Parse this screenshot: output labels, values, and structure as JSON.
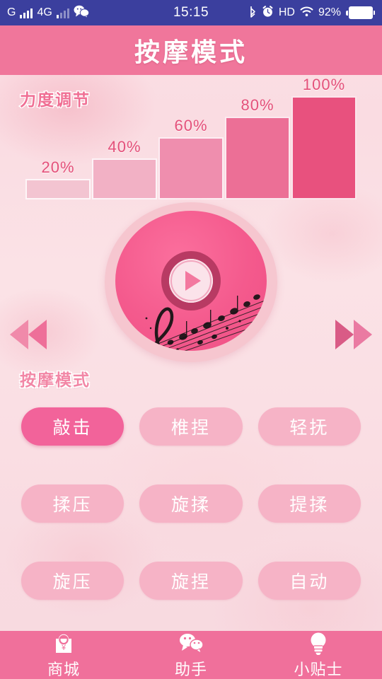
{
  "status_bar": {
    "carrier": "G",
    "network": "4G",
    "wechat_icon": "wechat-icon",
    "time": "15:15",
    "bluetooth_icon": "bluetooth-icon",
    "alarm_icon": "alarm-icon",
    "hd_label": "HD",
    "wifi_icon": "wifi-icon",
    "battery_percent": "92%",
    "background_color": "#3b3f9e"
  },
  "header": {
    "title": "按摩模式",
    "background_color": "#f0769b"
  },
  "intensity": {
    "label": "力度调节"
  },
  "chart_data": {
    "type": "bar",
    "title": "力度调节",
    "categories": [
      "20%",
      "40%",
      "60%",
      "80%",
      "100%"
    ],
    "values": [
      20,
      40,
      60,
      80,
      100
    ],
    "labels": [
      "20%",
      "40%",
      "60%",
      "80%",
      "100%"
    ],
    "colors": [
      "#f3c4d1",
      "#f2b1c5",
      "#ef8eae",
      "#ec6f96",
      "#e8517e"
    ],
    "xlabel": "",
    "ylabel": "",
    "ylim": [
      0,
      100
    ],
    "grid": false,
    "legend": "none"
  },
  "player": {
    "disc_name": "massage-disc",
    "play_button_label": "play",
    "prev_button_label": "previous",
    "next_button_label": "next"
  },
  "modes": {
    "label": "按摩模式",
    "selected": "敲击",
    "items": [
      {
        "label": "敲击",
        "active": true
      },
      {
        "label": "椎捏",
        "active": false
      },
      {
        "label": "轻抚",
        "active": false
      },
      {
        "label": "揉压",
        "active": false
      },
      {
        "label": "旋揉",
        "active": false
      },
      {
        "label": "提揉",
        "active": false
      },
      {
        "label": "旋压",
        "active": false
      },
      {
        "label": "旋捏",
        "active": false
      },
      {
        "label": "自动",
        "active": false
      }
    ]
  },
  "bottom_nav": {
    "items": [
      {
        "label": "商城",
        "icon": "shopping-bag-icon"
      },
      {
        "label": "助手",
        "icon": "chat-bubbles-icon"
      },
      {
        "label": "小贴士",
        "icon": "lightbulb-icon"
      }
    ],
    "background_color": "#f0709b"
  }
}
